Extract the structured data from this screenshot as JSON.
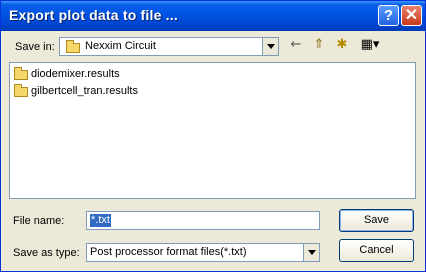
{
  "window": {
    "title": "Export plot data to file ...",
    "help_glyph": "?",
    "close_glyph": "✕"
  },
  "save_in": {
    "label": "Save in:",
    "value": "Nexxim Circuit"
  },
  "toolbar": {
    "back": "←",
    "up": "⇑",
    "new_folder": "✱",
    "view_menu": "▦▾"
  },
  "files": [
    {
      "name": "diodemixer.results"
    },
    {
      "name": "gilbertcell_tran.results"
    }
  ],
  "file_name": {
    "label": "File name:",
    "value": "*.txt"
  },
  "save_as_type": {
    "label": "Save as type:",
    "value": "Post processor format files(*.txt)"
  },
  "buttons": {
    "save": "Save",
    "cancel": "Cancel"
  }
}
